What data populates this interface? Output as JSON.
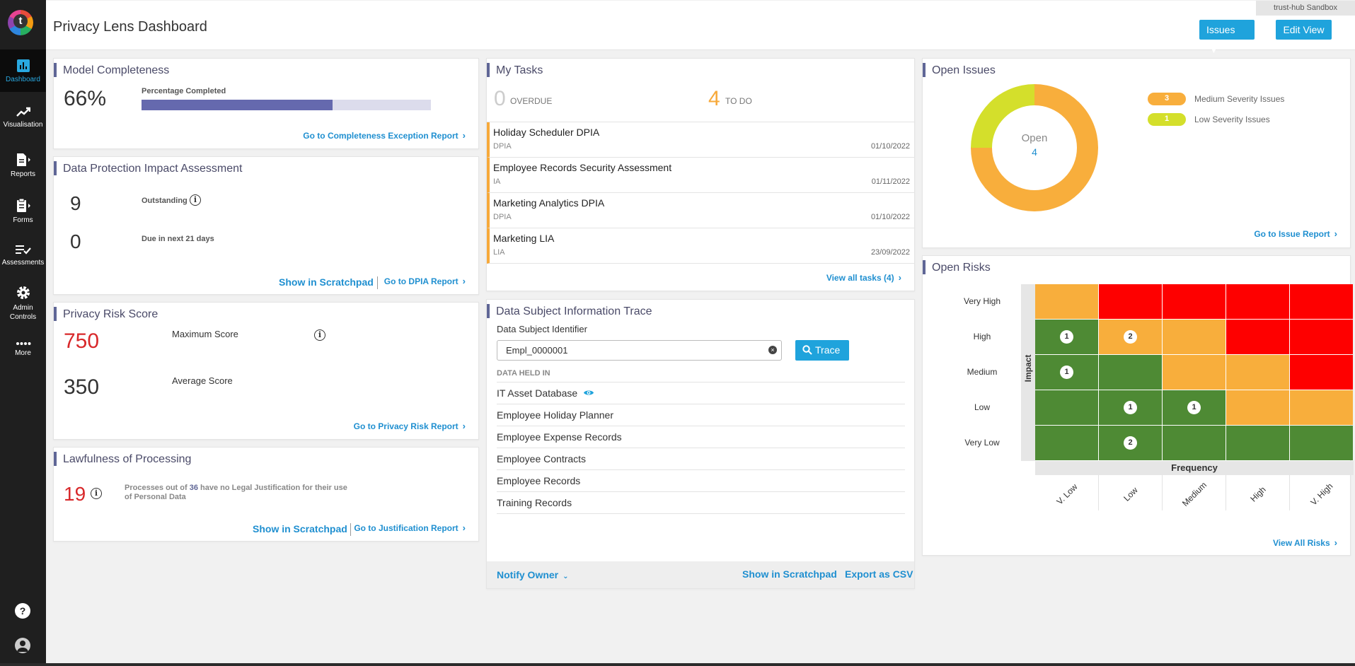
{
  "app": {
    "page_title": "Privacy Lens Dashboard",
    "sandbox_label": "trust-hub Sandbox"
  },
  "header": {
    "issues_label": "Issues",
    "edit_view_label": "Edit View"
  },
  "sidebar": {
    "items": [
      {
        "label": "Dashboard",
        "icon": "bar-chart-icon"
      },
      {
        "label": "Visualisation",
        "icon": "trend-line-icon"
      },
      {
        "label": "Reports",
        "icon": "document-icon"
      },
      {
        "label": "Forms",
        "icon": "clipboard-icon"
      },
      {
        "label": "Assessments",
        "icon": "checklist-icon"
      },
      {
        "label": "Admin Controls",
        "icon": "gear-icon"
      },
      {
        "label": "More",
        "icon": "more-dots-icon"
      }
    ],
    "help_icon": "help-icon",
    "user_icon": "user-icon"
  },
  "model_completeness": {
    "title": "Model Completeness",
    "percent_text": "66%",
    "progress_label": "Percentage Completed",
    "progress_fraction": 0.66,
    "link": "Go to Completeness Exception Report"
  },
  "dpia": {
    "title": "Data Protection Impact Assessment",
    "outstanding_count": "9",
    "outstanding_label": "Outstanding",
    "due_count": "0",
    "due_label": "Due in next 21 days",
    "scratchpad_link": "Show in Scratchpad",
    "report_link": "Go to DPIA Report"
  },
  "privacy_risk": {
    "title": "Privacy Risk Score",
    "max_score": "750",
    "max_label": "Maximum Score",
    "avg_score": "350",
    "avg_label": "Average Score",
    "link": "Go to Privacy Risk Report"
  },
  "lawfulness": {
    "title": "Lawfulness of Processing",
    "count": "19",
    "text_before": "Processes out of ",
    "total": "36",
    "text_after": " have no Legal Justification for their use of Personal Data",
    "scratchpad_link": "Show in Scratchpad",
    "report_link": "Go to Justification Report"
  },
  "tasks": {
    "title": "My Tasks",
    "overdue_count": "0",
    "overdue_label": "OVERDUE",
    "todo_count": "4",
    "todo_label": "TO DO",
    "items": [
      {
        "name": "Holiday Scheduler DPIA",
        "type": "DPIA",
        "date": "01/10/2022"
      },
      {
        "name": "Employee Records Security Assessment",
        "type": "IA",
        "date": "01/11/2022"
      },
      {
        "name": "Marketing Analytics DPIA",
        "type": "DPIA",
        "date": "01/10/2022"
      },
      {
        "name": "Marketing LIA",
        "type": "LIA",
        "date": "23/09/2022"
      }
    ],
    "view_all": "View all tasks (4)"
  },
  "trace": {
    "title": "Data Subject Information Trace",
    "identifier_label": "Data Subject Identifier",
    "identifier_value": "Empl_0000001",
    "trace_button": "Trace",
    "held_in_label": "DATA HELD IN",
    "held_in": [
      "IT Asset Database",
      "Employee Holiday Planner",
      "Employee Expense Records",
      "Employee Contracts",
      "Employee Records",
      "Training Records"
    ],
    "notify_owner": "Notify Owner",
    "show_scratchpad": "Show in Scratchpad",
    "export_csv": "Export as CSV"
  },
  "open_issues": {
    "title": "Open Issues",
    "center_label": "Open",
    "center_count": "4",
    "legend": [
      {
        "count": "3",
        "label": "Medium Severity Issues",
        "color": "#f8ae3c"
      },
      {
        "count": "1",
        "label": "Low Severity Issues",
        "color": "#d4df2b"
      }
    ],
    "link": "Go to Issue Report"
  },
  "open_risks": {
    "title": "Open Risks",
    "impact_label": "Impact",
    "frequency_label": "Frequency",
    "rows": [
      "Very High",
      "High",
      "Medium",
      "Low",
      "Very Low"
    ],
    "cols": [
      "V. Low",
      "Low",
      "Medium",
      "High",
      "V. High"
    ],
    "colors": {
      "green": "#4e8a34",
      "orange": "#f8ae3c",
      "red": "#fe0000"
    },
    "link": "View All Risks"
  },
  "chart_data": [
    {
      "type": "pie",
      "title": "Open Issues",
      "categories": [
        "Medium Severity Issues",
        "Low Severity Issues"
      ],
      "values": [
        3,
        1
      ],
      "colors": [
        "#f8ae3c",
        "#d4df2b"
      ]
    },
    {
      "type": "heatmap",
      "title": "Open Risks",
      "xlabel": "Frequency",
      "ylabel": "Impact",
      "x": [
        "V. Low",
        "Low",
        "Medium",
        "High",
        "V. High"
      ],
      "y": [
        "Very High",
        "High",
        "Medium",
        "Low",
        "Very Low"
      ],
      "cell_colors": [
        [
          "orange",
          "red",
          "red",
          "red",
          "red"
        ],
        [
          "green",
          "orange",
          "orange",
          "red",
          "red"
        ],
        [
          "green",
          "green",
          "orange",
          "orange",
          "red"
        ],
        [
          "green",
          "green",
          "green",
          "orange",
          "orange"
        ],
        [
          "green",
          "green",
          "green",
          "green",
          "green"
        ]
      ],
      "counts": [
        [
          null,
          null,
          null,
          null,
          null
        ],
        [
          1,
          2,
          null,
          null,
          null
        ],
        [
          1,
          null,
          null,
          null,
          null
        ],
        [
          null,
          1,
          1,
          null,
          null
        ],
        [
          null,
          2,
          null,
          null,
          null
        ]
      ]
    }
  ]
}
